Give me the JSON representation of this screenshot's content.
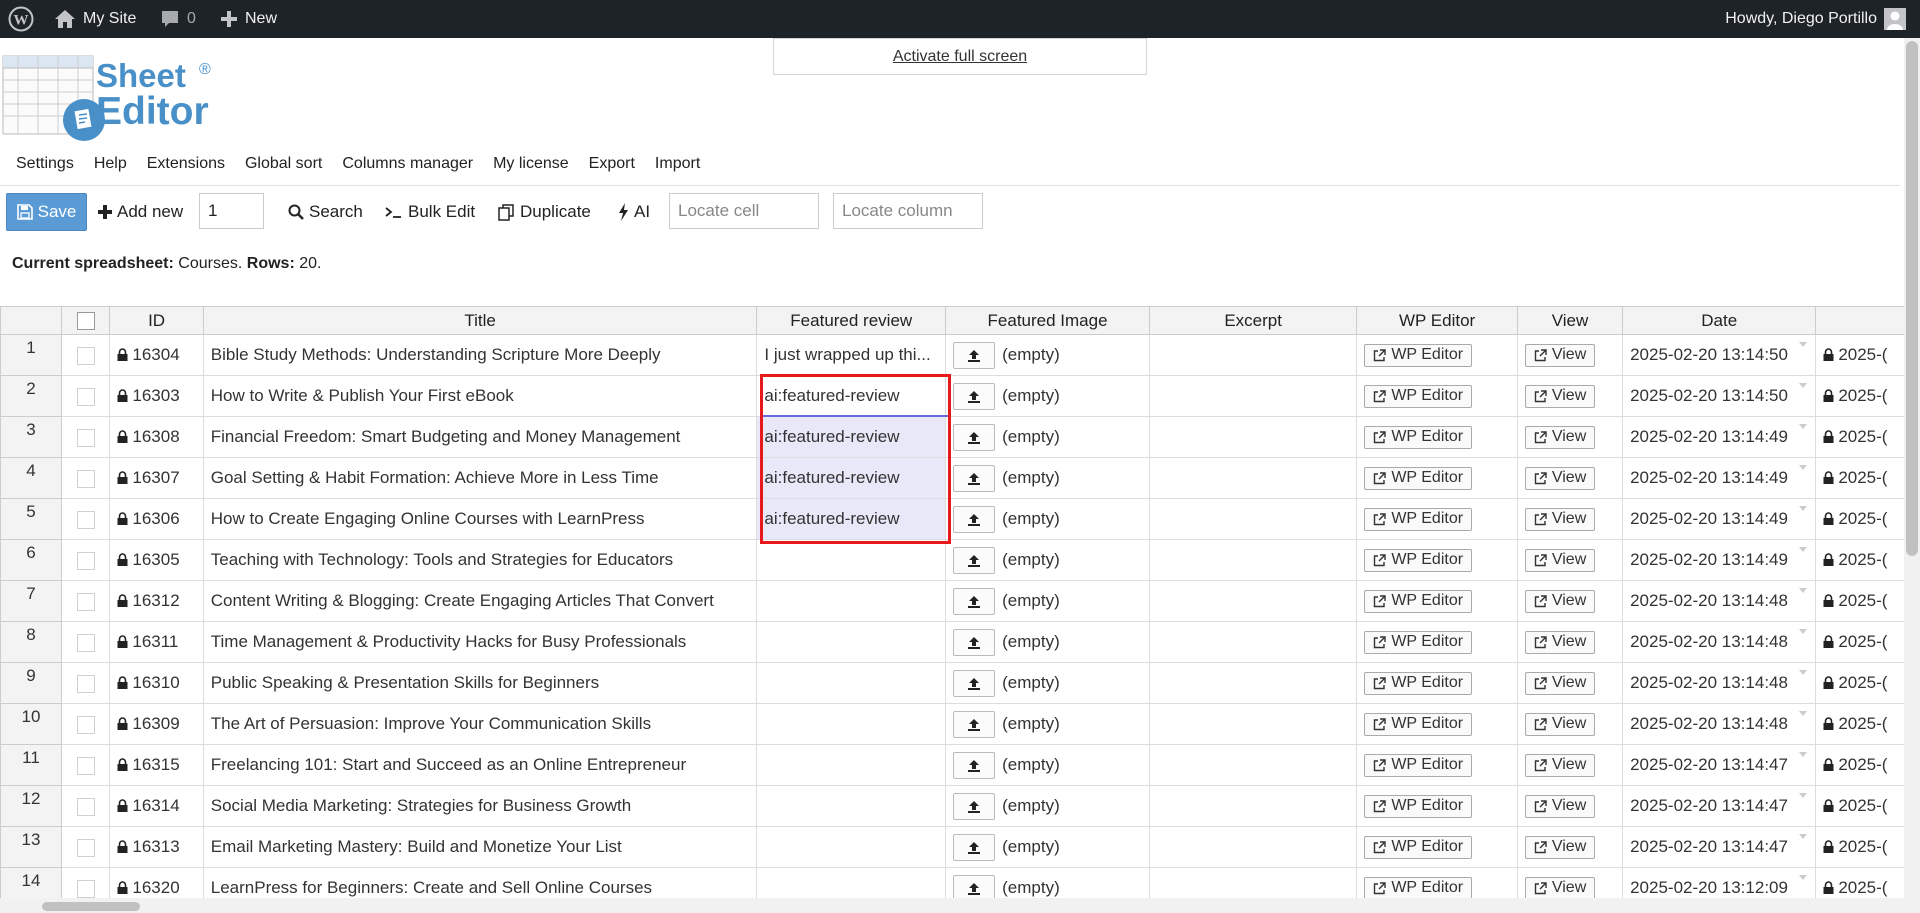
{
  "admin_bar": {
    "site_name": "My Site",
    "comments_count": "0",
    "new_label": "New",
    "greeting": "Howdy, Diego Portillo",
    "icons": [
      "wordpress-icon",
      "home-icon",
      "comment-icon",
      "plus-icon",
      "user-avatar-icon"
    ]
  },
  "logo": {
    "line1": "Sheet",
    "line2": "Editor",
    "mark": "®"
  },
  "fullscreen_label": "Activate full screen",
  "menu": [
    "Settings",
    "Help",
    "Extensions",
    "Global sort",
    "Columns manager",
    "My license",
    "Export",
    "Import"
  ],
  "toolbar": {
    "save": "Save",
    "add_new": "Add new",
    "add_new_count": "1",
    "search": "Search",
    "bulk_edit": "Bulk Edit",
    "duplicate": "Duplicate",
    "ai": "AI",
    "locate_cell_placeholder": "Locate cell",
    "locate_column_placeholder": "Locate column"
  },
  "sheet_info": {
    "label": "Current spreadsheet:",
    "name": "Courses.",
    "rows_label": "Rows:",
    "rows_count": "20."
  },
  "columns": [
    "ID",
    "Title",
    "Featured review",
    "Featured Image",
    "Excerpt",
    "WP Editor",
    "View",
    "Date"
  ],
  "cell_labels": {
    "empty": "(empty)",
    "wp_editor": "WP Editor",
    "view": "View"
  },
  "rows": [
    {
      "num": "1",
      "id": "16304",
      "title": "Bible Study Methods: Understanding Scripture More Deeply",
      "review": "I just wrapped up thi...",
      "date": "2025-02-20 13:14:50",
      "next": "2025-("
    },
    {
      "num": "2",
      "id": "16303",
      "title": "How to Write & Publish Your First eBook",
      "review": "ai:featured-review",
      "date": "2025-02-20 13:14:50",
      "next": "2025-("
    },
    {
      "num": "3",
      "id": "16308",
      "title": "Financial Freedom: Smart Budgeting and Money Management",
      "review": "ai:featured-review",
      "date": "2025-02-20 13:14:49",
      "next": "2025-("
    },
    {
      "num": "4",
      "id": "16307",
      "title": "Goal Setting & Habit Formation: Achieve More in Less Time",
      "review": "ai:featured-review",
      "date": "2025-02-20 13:14:49",
      "next": "2025-("
    },
    {
      "num": "5",
      "id": "16306",
      "title": "How to Create Engaging Online Courses with LearnPress",
      "review": "ai:featured-review",
      "date": "2025-02-20 13:14:49",
      "next": "2025-("
    },
    {
      "num": "6",
      "id": "16305",
      "title": "Teaching with Technology: Tools and Strategies for Educators",
      "review": "",
      "date": "2025-02-20 13:14:49",
      "next": "2025-("
    },
    {
      "num": "7",
      "id": "16312",
      "title": "Content Writing & Blogging: Create Engaging Articles That Convert",
      "review": "",
      "date": "2025-02-20 13:14:48",
      "next": "2025-("
    },
    {
      "num": "8",
      "id": "16311",
      "title": "Time Management & Productivity Hacks for Busy Professionals",
      "review": "",
      "date": "2025-02-20 13:14:48",
      "next": "2025-("
    },
    {
      "num": "9",
      "id": "16310",
      "title": "Public Speaking & Presentation Skills for Beginners",
      "review": "",
      "date": "2025-02-20 13:14:48",
      "next": "2025-("
    },
    {
      "num": "10",
      "id": "16309",
      "title": "The Art of Persuasion: Improve Your Communication Skills",
      "review": "",
      "date": "2025-02-20 13:14:48",
      "next": "2025-("
    },
    {
      "num": "11",
      "id": "16315",
      "title": "Freelancing 101: Start and Succeed as an Online Entrepreneur",
      "review": "",
      "date": "2025-02-20 13:14:47",
      "next": "2025-("
    },
    {
      "num": "12",
      "id": "16314",
      "title": "Social Media Marketing: Strategies for Business Growth",
      "review": "",
      "date": "2025-02-20 13:14:47",
      "next": "2025-("
    },
    {
      "num": "13",
      "id": "16313",
      "title": "Email Marketing Mastery: Build and Monetize Your List",
      "review": "",
      "date": "2025-02-20 13:14:47",
      "next": "2025-("
    },
    {
      "num": "14",
      "id": "16320",
      "title": "LearnPress for Beginners: Create and Sell Online Courses",
      "review": "",
      "date": "2025-02-20 13:12:09",
      "next": "2025-("
    }
  ],
  "colors": {
    "admin_bar": "#1d2327",
    "save_button": "#5b9bd5",
    "selection_highlight": "#e8e8f8",
    "callout_box": "#e8191c",
    "logo_blue": "#4a90c8"
  }
}
